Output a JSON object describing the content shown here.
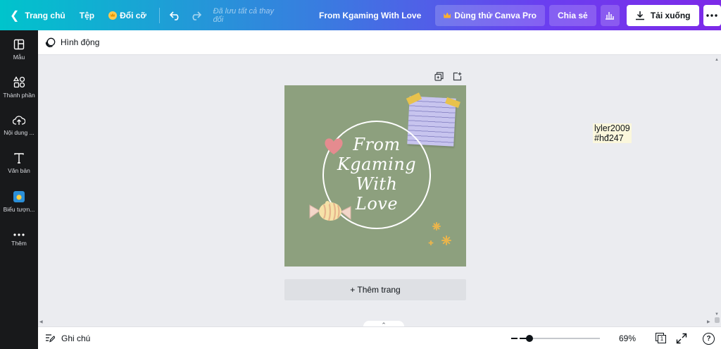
{
  "topbar": {
    "home_label": "Trang chủ",
    "file_label": "Tệp",
    "resize_label": "Đổi cỡ",
    "saved_status": "Đã lưu tất cả thay đổi",
    "doc_title": "From Kgaming With Love",
    "try_pro_label": "Dùng thử Canva Pro",
    "share_label": "Chia sẻ",
    "download_label": "Tải xuống"
  },
  "sidebar": {
    "items": [
      {
        "label": "Mẫu",
        "icon": "template-icon"
      },
      {
        "label": "Thành phần",
        "icon": "elements-icon"
      },
      {
        "label": "Nội dung ...",
        "icon": "upload-icon"
      },
      {
        "label": "Văn bản",
        "icon": "text-icon"
      },
      {
        "label": "Biểu tượn...",
        "icon": "app-icon"
      },
      {
        "label": "Thêm",
        "icon": "more-icon"
      }
    ]
  },
  "subbar": {
    "animate_label": "Hình động"
  },
  "design": {
    "text_lines": [
      "From",
      "Kgaming",
      "With",
      "Love"
    ],
    "background_color": "#8da07e"
  },
  "add_page_label": "+ Thêm trang",
  "sticky_note": {
    "line1": "lyler2009",
    "line2": "#hđ247"
  },
  "bottombar": {
    "notes_label": "Ghi chú",
    "zoom_label": "69%",
    "zoom_level": 0.69,
    "page_count": "1"
  },
  "colors": {
    "gradient_start": "#00c4cc",
    "gradient_end": "#7d2ae8",
    "sidebar_bg": "#18191b",
    "canvas_bg": "#ebecf0"
  }
}
